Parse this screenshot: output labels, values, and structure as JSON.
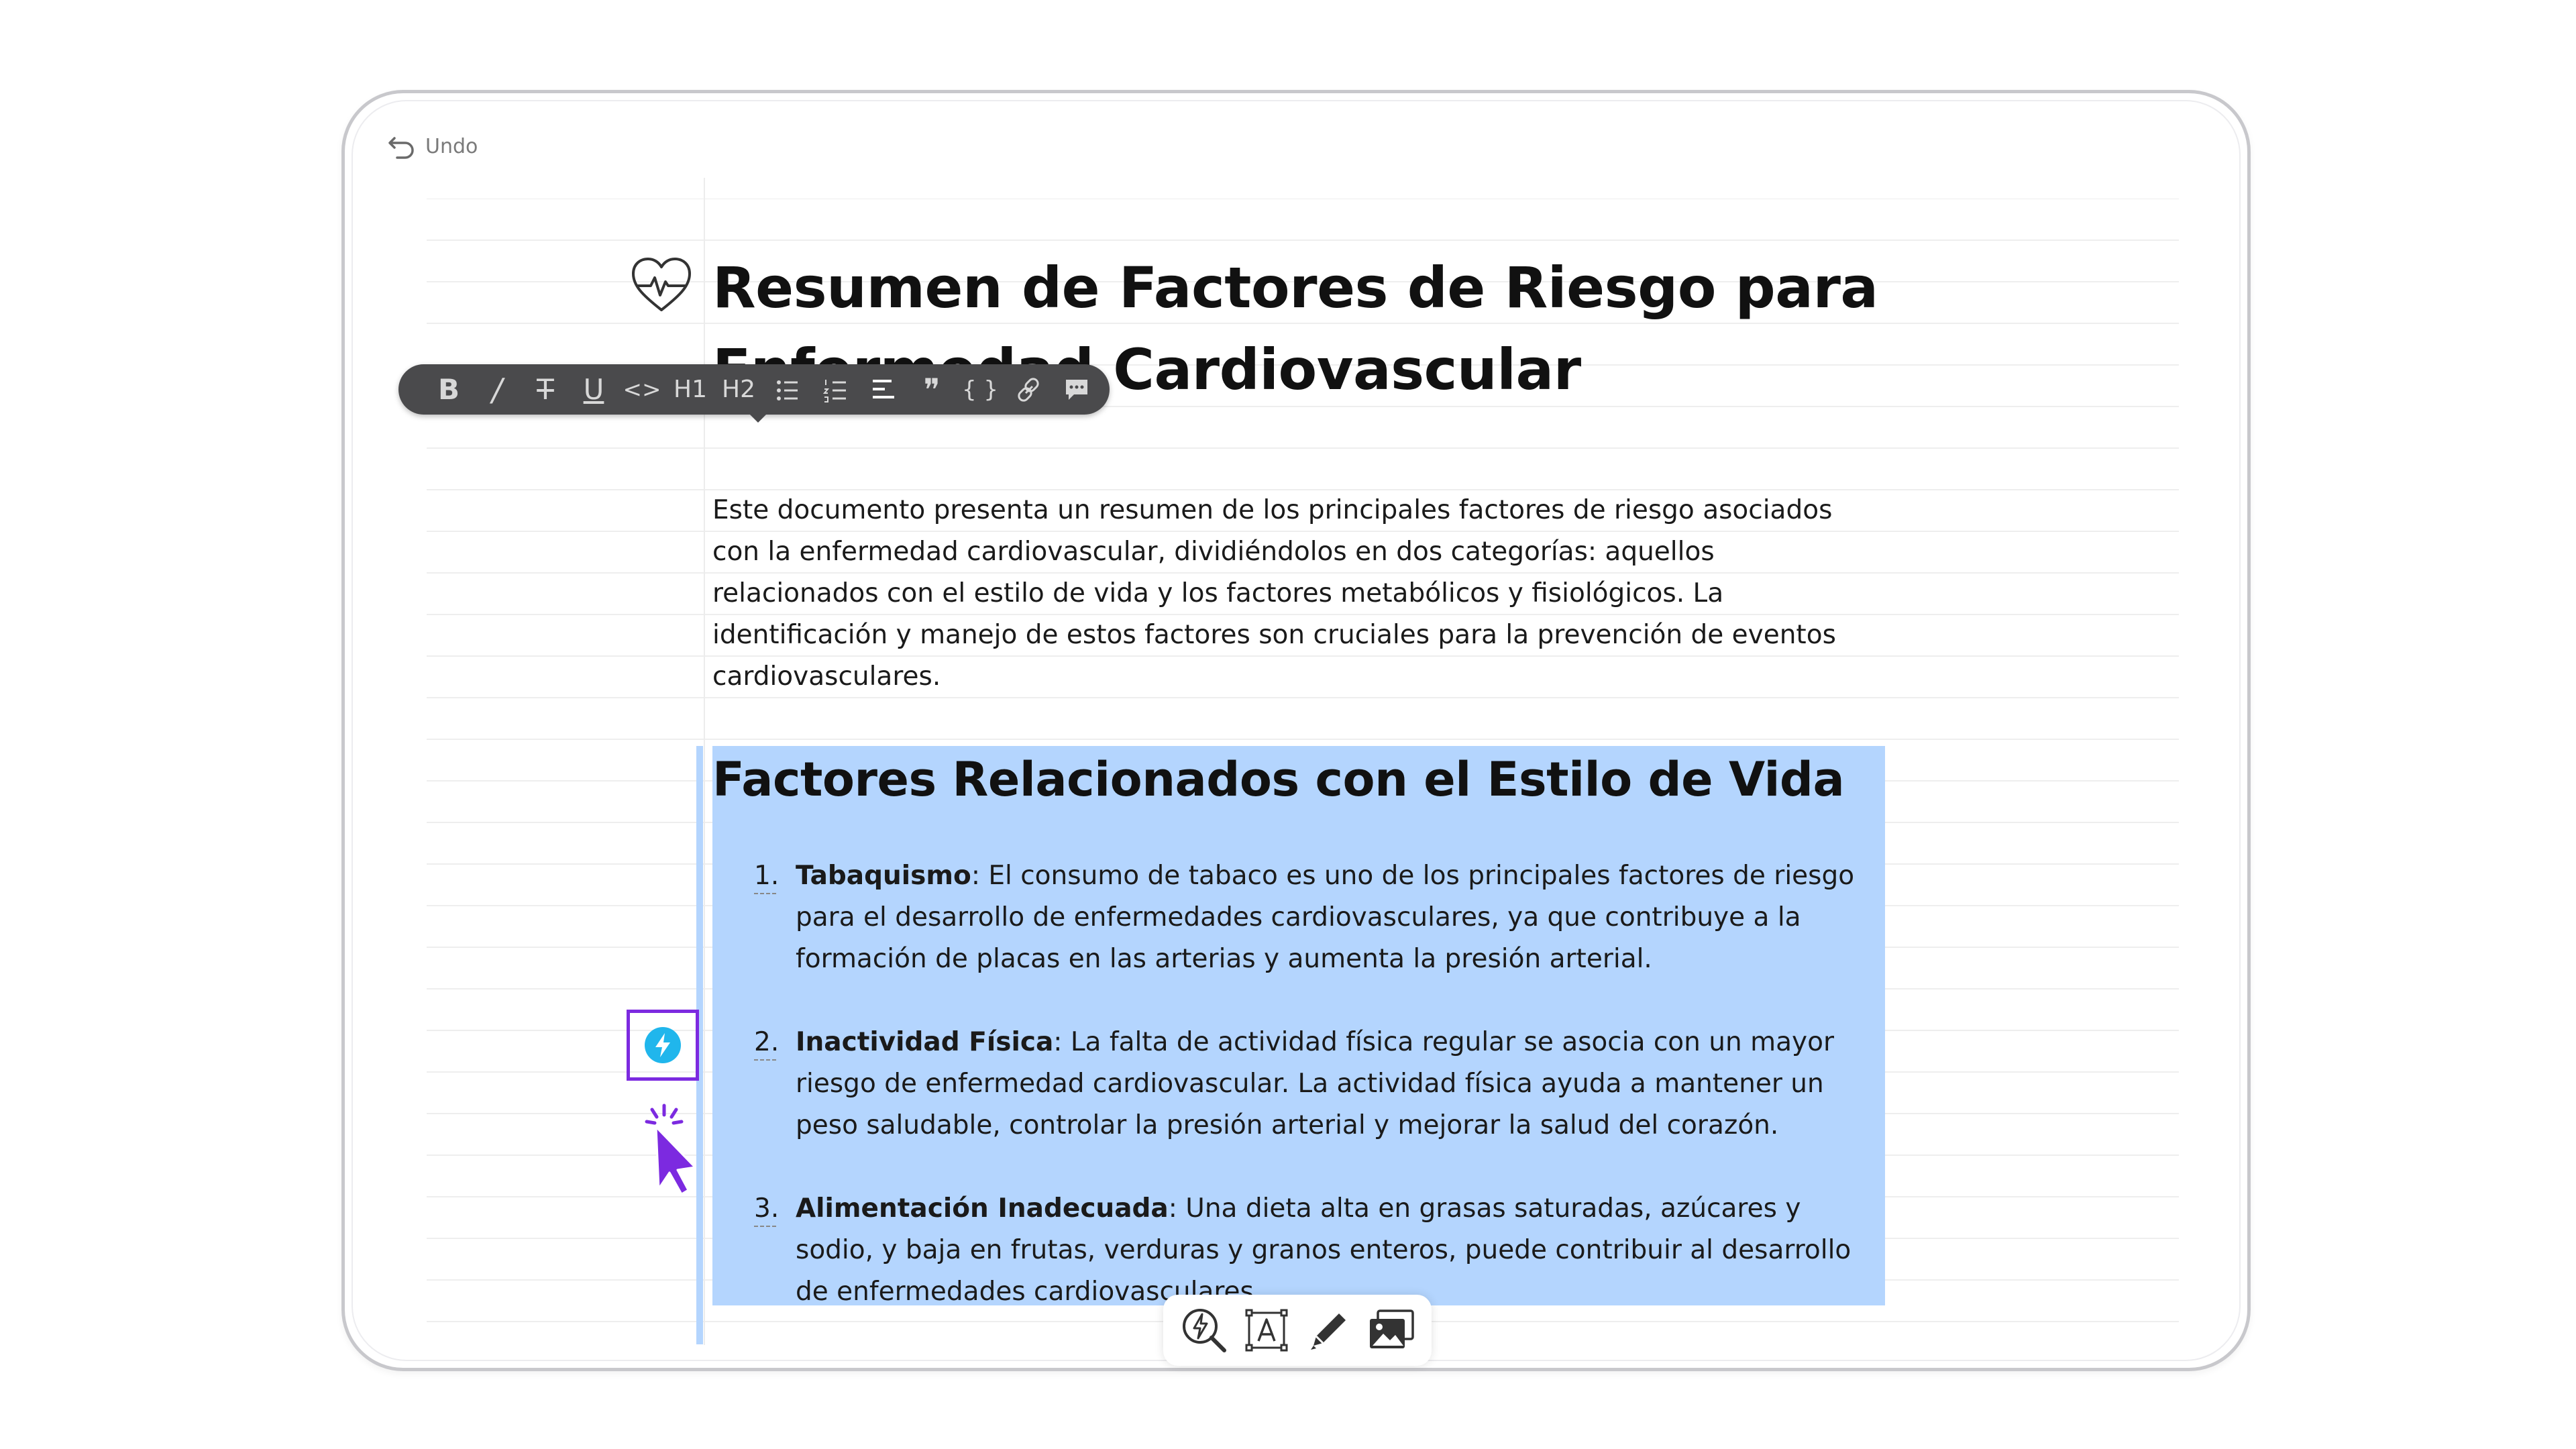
{
  "undo": {
    "label": "Undo"
  },
  "document": {
    "title": "Resumen de Factores de Riesgo para Enfermedad Cardiovascular",
    "intro": "Este documento presenta un resumen de los principales factores de riesgo asociados con la enfermedad cardiovascular, dividiéndolos en dos categorías: aquellos relacionados con el estilo de vida y los factores metabólicos y fisiológicos. La identificación y manejo de estos factores son cruciales para la prevención de eventos cardiovasculares.",
    "section_heading": "Factores Relacionados con el Estilo de Vida",
    "items": [
      {
        "number": "1.",
        "term": "Tabaquismo",
        "text": ": El consumo de tabaco es uno de los principales factores de riesgo para el desarrollo de enfermedades cardiovasculares, ya que contribuye a la formación de placas en las arterias y aumenta la presión arterial."
      },
      {
        "number": "2.",
        "term": "Inactividad Física",
        "text": ": La falta de actividad física regular se asocia con un mayor riesgo de enfermedad cardiovascular. La actividad física ayuda a mantener un peso saludable, controlar la presión arterial y mejorar la salud del corazón."
      },
      {
        "number": "3.",
        "term": "Alimentación Inadecuada",
        "text": ": Una dieta alta en grasas saturadas, azúcares y sodio, y baja en frutas, verduras y granos enteros, puede contribuir al desarrollo de enfermedades cardiovasculares."
      }
    ]
  },
  "format_toolbar": {
    "buttons": [
      {
        "name": "bold",
        "glyph": "B"
      },
      {
        "name": "italic",
        "glyph": "/"
      },
      {
        "name": "strikethrough",
        "glyph": "T"
      },
      {
        "name": "underline",
        "glyph": "U"
      },
      {
        "name": "code",
        "glyph": "<>"
      },
      {
        "name": "heading-1",
        "glyph": "H1"
      },
      {
        "name": "heading-2",
        "glyph": "H2"
      },
      {
        "name": "bullet-list",
        "glyph": ""
      },
      {
        "name": "numbered-list",
        "glyph": ""
      },
      {
        "name": "align",
        "glyph": ""
      },
      {
        "name": "quote",
        "glyph": "❞"
      },
      {
        "name": "code-block",
        "glyph": "{ }"
      },
      {
        "name": "link",
        "glyph": ""
      },
      {
        "name": "comment",
        "glyph": ""
      }
    ]
  },
  "icons": {
    "document_icon": "heart-pulse-icon",
    "block_action": "lightning-icon",
    "bottom_tools": [
      "ai-search-icon",
      "text-box-icon",
      "pen-icon",
      "image-icon"
    ]
  },
  "colors": {
    "selection": "#b4d5fe",
    "highlight_box": "#7c2ae0",
    "bolt": "#20b6ec",
    "toolbar": "#4a4a4c"
  }
}
